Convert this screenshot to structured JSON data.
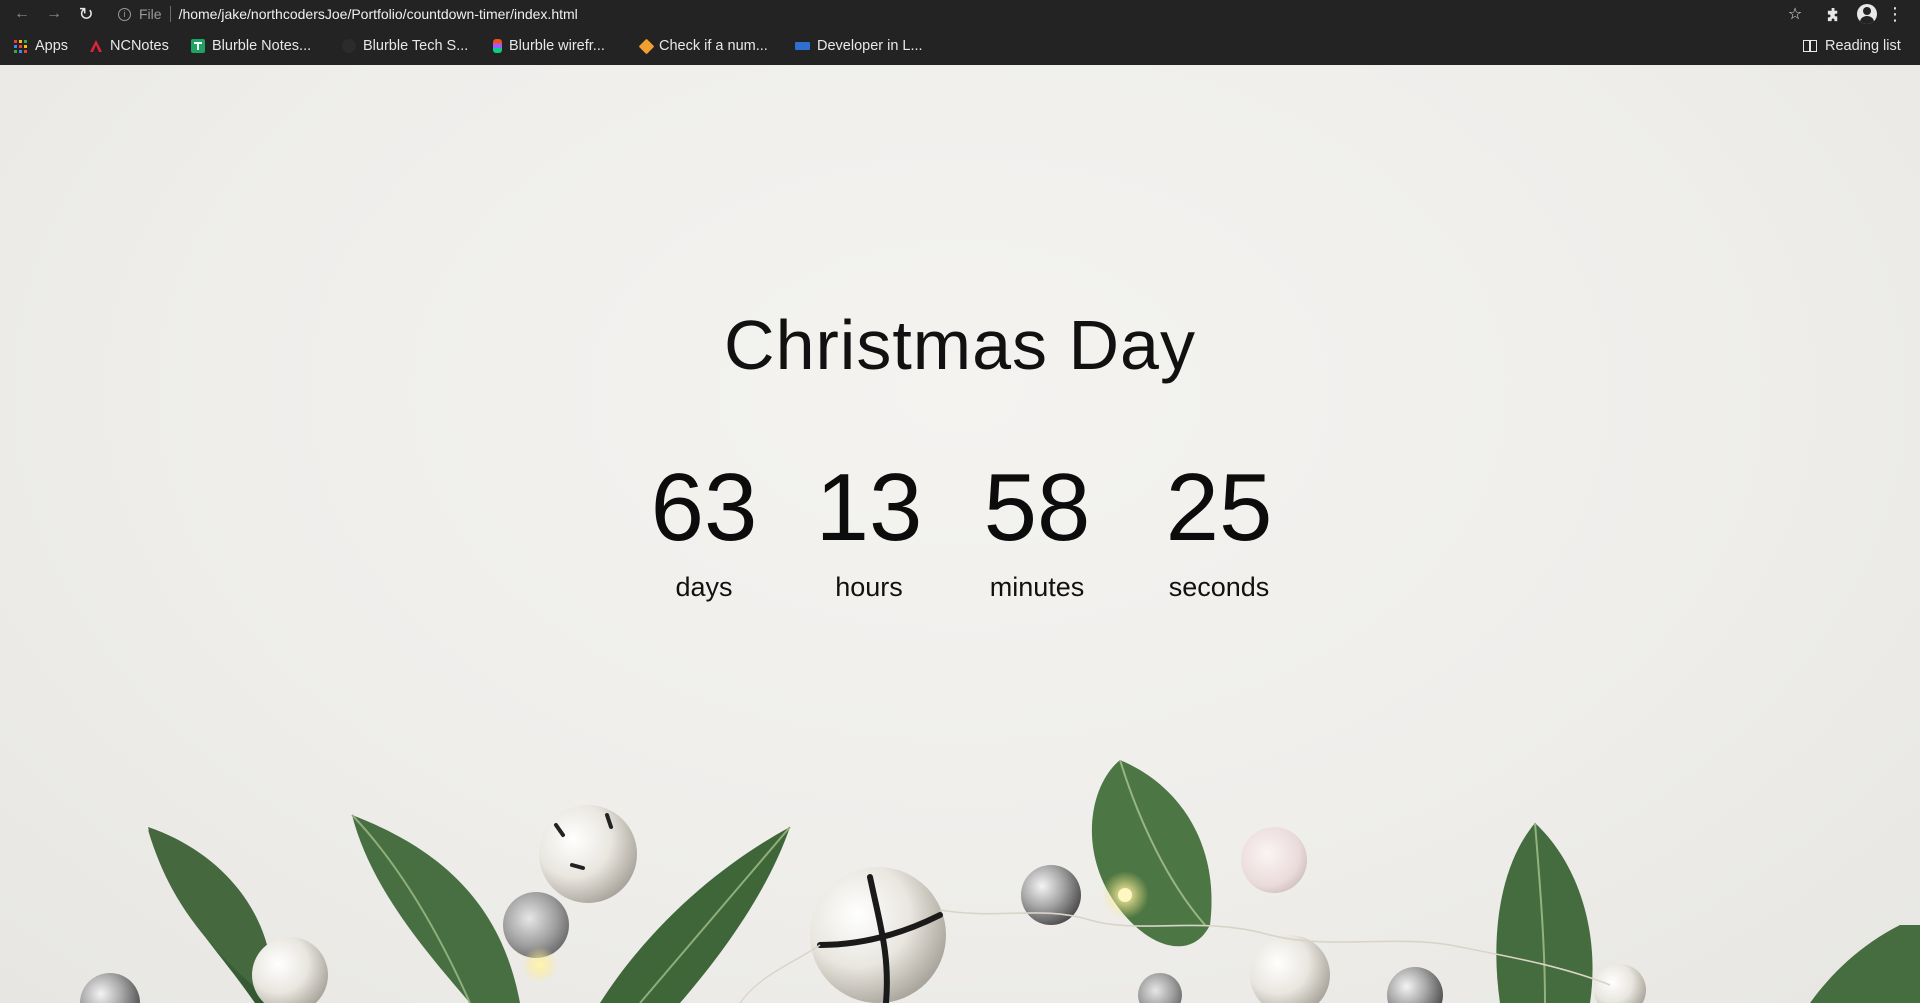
{
  "browser": {
    "url_scheme": "File",
    "url": "/home/jake/northcodersJoe/Portfolio/countdown-timer/index.html",
    "bookmarks": [
      {
        "label": "Apps",
        "icon": "apps-grid-icon"
      },
      {
        "label": "NCNotes",
        "icon": "nc-logo-icon",
        "color": "#e0243b"
      },
      {
        "label": "Blurble Notes...",
        "icon": "sheets-icon",
        "color": "#1ea362"
      },
      {
        "label": "Blurble Tech S...",
        "icon": "github-icon",
        "color": "#2b2b2b"
      },
      {
        "label": "Blurble wirefr...",
        "icon": "figma-icon",
        "color": "#f24e1e"
      },
      {
        "label": "Check if a num...",
        "icon": "diamond-icon",
        "color": "#f0a030"
      },
      {
        "label": "Developer in L...",
        "icon": "nhs-icon",
        "color": "#2f6fd0"
      }
    ],
    "reading_list": "Reading list"
  },
  "page": {
    "title": "Christmas Day",
    "countdown": [
      {
        "value": "63",
        "label": "days"
      },
      {
        "value": "13",
        "label": "hours"
      },
      {
        "value": "58",
        "label": "minutes"
      },
      {
        "value": "25",
        "label": "seconds"
      }
    ]
  }
}
